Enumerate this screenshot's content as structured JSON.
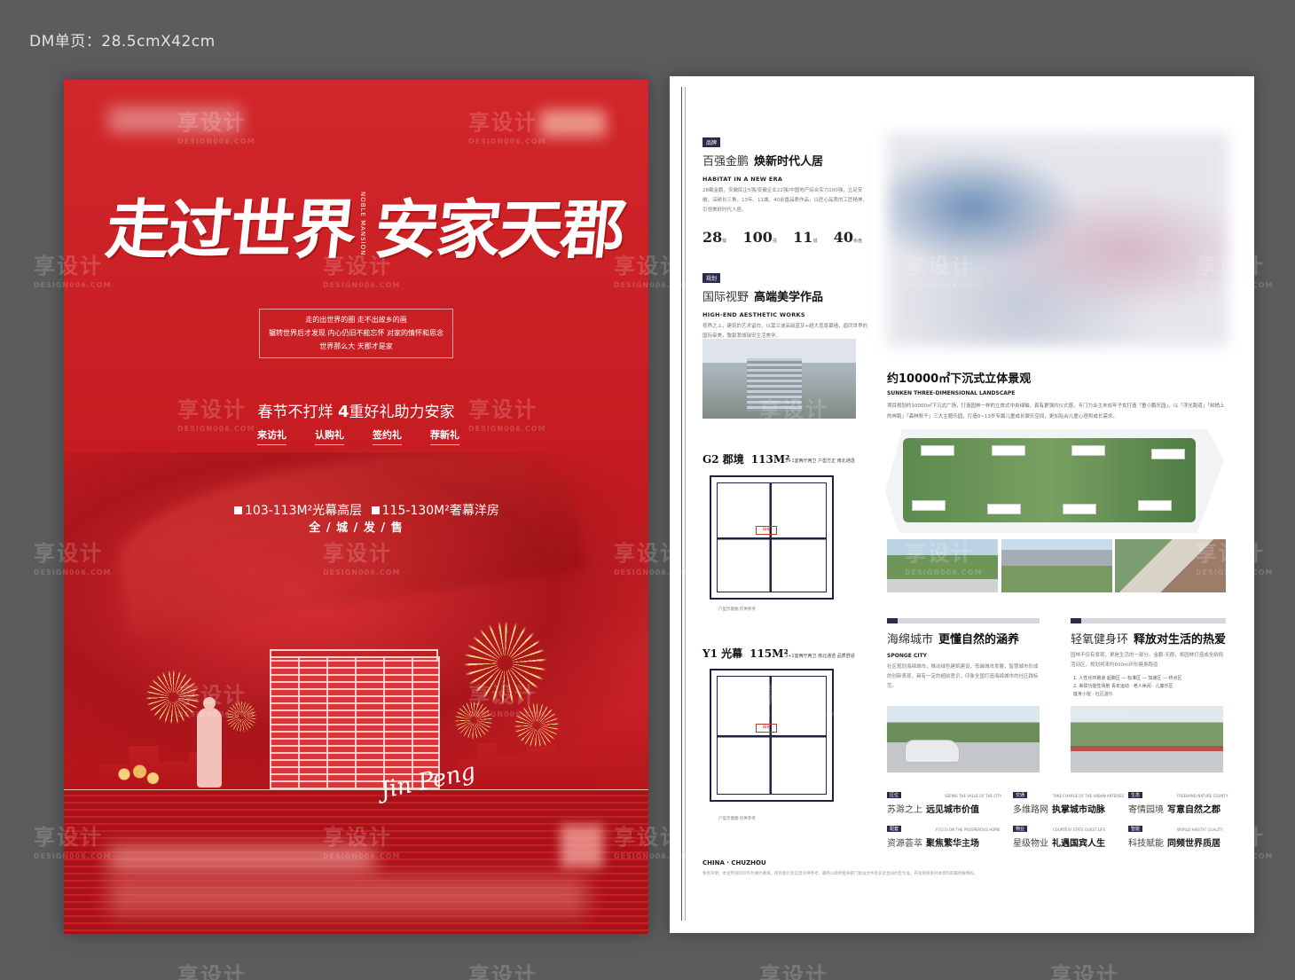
{
  "spec_label": "DM单页：28.5cmX42cm",
  "front": {
    "headline": "走过世界 安家天郡",
    "headline_en": "NOBLE MANSION",
    "slogan": [
      "走的出世界的圈 走不出故乡的画",
      "辗转世界后才发现 内心仍旧不能忘怀 对家的情怀和思念",
      "世界那么大 天郡才是家"
    ],
    "promo_prefix": "春节不打烊",
    "promo_highlight": "4",
    "promo_suffix": "重好礼助力安家",
    "gifts": [
      "来访礼",
      "认购礼",
      "签约礼",
      "荐新礼"
    ],
    "area_line_1": "103-113M²光幕高层",
    "area_line_2": "115-130M²奢幕洋房",
    "sale_line": "全 / 城 / 发 / 售",
    "signature": "Jin Peng"
  },
  "back": {
    "brand": {
      "tag": "品牌",
      "title_light": "百强金鹏",
      "title_bold": "焕新时代人居",
      "en": "HABITAT IN A NEW ERA",
      "text": "28载金鹏，安徽民企5强/安徽企业22强/中国地产综合实力100强，立足安徽，深耕长三角，13年、11城、40余盘品质作品，以匠心品质的工匠精神，引领美好时代人居。",
      "stats": [
        {
          "num": "28",
          "unit": "载"
        },
        {
          "num": "100",
          "unit": "强"
        },
        {
          "num": "11",
          "unit": "城"
        },
        {
          "num": "40",
          "unit": "余盘"
        }
      ]
    },
    "design": {
      "tag": "规划",
      "title_light": "国际视野",
      "title_bold": "高端美学作品",
      "en": "HIGH-END AESTHETIC WORKS",
      "text": "视界之上，建筑的艺术留白，以莫兰迪高级蓝灰+超大宽景幕墙，趋同世界的国际审美，敬献滁城瑞安生活美学。"
    },
    "plan_g2": {
      "title": "G2 郡境",
      "area": "113M²",
      "sub": "3+1室两厅两卫  户型方正  南北通透",
      "legend": "户型示意图  仅供参考"
    },
    "plan_y1": {
      "title": "Y1 光幕",
      "area": "115M²",
      "sub": "3+1室两厅两卫  南北通透  品质舒适",
      "legend": "户型示意图  仅供参考"
    },
    "landscape": {
      "title": "约10000㎡下沉式立体景观",
      "en": "SUNKEN THREE-DIMENSIONAL LANDSCAPE",
      "text": "项目规划约10000㎡下沉式广场，打造园林一样的立体式中央绿轴，真有更强的仪式感，专门为业主未成年子女打造「童小鹏乐园」，以「浮光跑道」「树梢上的奔跑」「森林秋千」三大主题乐园，打造0~13岁专属儿童成长娱乐空间，更加贴合儿童心理和成长需求。"
    },
    "sponge": {
      "title_light": "海绵城市",
      "title_bold": "更懂自然的涵养",
      "en": "SPONGE CITY",
      "text": "社区规划海绵城市，推动绿色建筑建设，低碳城市发展，智慧城市形成的创新表现，具有一定的超前意识，印象全国打造海绵城市的社区践标范。"
    },
    "oxygen": {
      "title_light": "轻氧健身环",
      "title_bold": "释放对生活的热爱",
      "text": "园林不仅有景观，更是生活的一部分。金鹏·天郡，将园林打造成全龄段活动区，规划将来约600m环形健身跑道",
      "list": [
        "1. 人性化环跑道    起跑区 — 标准区 — 加速区 — 终点区",
        "2. 串联功能性场景    青年运动 · 老人休闲 · 儿童乐区",
        "健身小屋 · 社区游乐"
      ]
    },
    "features": [
      {
        "tag": "区位",
        "en": "SEEING THE VALUE OF THE CITY",
        "light": "苏滁之上",
        "bold": "远见城市价值"
      },
      {
        "tag": "交通",
        "en": "TAKE CHARGE OF THE URBAN ARTERIES",
        "light": "多维路网",
        "bold": "执掌城市动脉"
      },
      {
        "tag": "生态",
        "en": "FREEHAND NATURE COUNTY",
        "light": "寄情园境",
        "bold": "写意自然之郡"
      },
      {
        "tag": "配套",
        "en": "FOCUS ON THE PROSPEROUS HOME",
        "light": "资源荟萃",
        "bold": "聚焦繁华主场"
      },
      {
        "tag": "物业",
        "en": "COURTESY STATE GUEST LIFE",
        "light": "星级物业",
        "bold": "礼遇国宾人生"
      },
      {
        "tag": "智能",
        "en": "WORLD HABITAT QUALITY",
        "light": "科技赋能",
        "bold": "同频世界质居"
      }
    ],
    "footer_en": "CHINA · CHUZHOU",
    "footer_fine": "免责声明：本宣传资料仅作为要约邀请，所有图片及信息仅供参考，最终以政府相关部门批准文件及买卖合同约定为准。开发商保留对本资料的最终解释权。"
  },
  "watermark": "享设计"
}
